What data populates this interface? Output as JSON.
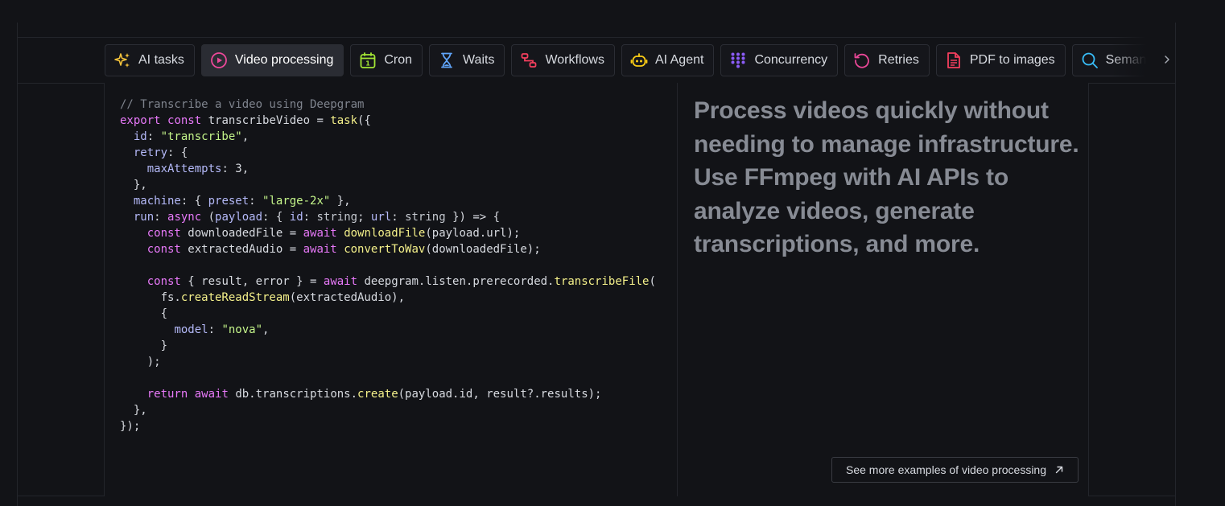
{
  "tabs": [
    {
      "label": "AI tasks",
      "icon": "sparkles-icon",
      "color": "#f5c33b",
      "active": false
    },
    {
      "label": "Video processing",
      "icon": "play-circle-icon",
      "color": "#ec4899",
      "active": true
    },
    {
      "label": "Cron",
      "icon": "calendar-icon",
      "color": "#a3e635",
      "active": false
    },
    {
      "label": "Waits",
      "icon": "hourglass-icon",
      "color": "#60a5fa",
      "active": false
    },
    {
      "label": "Workflows",
      "icon": "workflow-icon",
      "color": "#f43f5e",
      "active": false
    },
    {
      "label": "AI Agent",
      "icon": "robot-icon",
      "color": "#facc15",
      "active": false
    },
    {
      "label": "Concurrency",
      "icon": "grid-dots-icon",
      "color": "#8b5cf6",
      "active": false
    },
    {
      "label": "Retries",
      "icon": "retry-icon",
      "color": "#ec4899",
      "active": false
    },
    {
      "label": "PDF to images",
      "icon": "pdf-file-icon",
      "color": "#f43f5e",
      "active": false
    },
    {
      "label": "Semantic search",
      "icon": "search-icon",
      "color": "#38bdf8",
      "active": false
    }
  ],
  "code_lines": [
    "// Transcribe a video using Deepgram",
    "export const transcribeVideo = task({",
    "  id: \"transcribe\",",
    "  retry: {",
    "    maxAttempts: 3,",
    "  },",
    "  machine: { preset: \"large-2x\" },",
    "  run: async (payload: { id: string; url: string }) => {",
    "    const downloadedFile = await downloadFile(payload.url);",
    "    const extractedAudio = await convertToWav(downloadedFile);",
    "",
    "    const { result, error } = await deepgram.listen.prerecorded.transcribeFile(",
    "      fs.createReadStream(extractedAudio),",
    "      {",
    "        model: \"nova\",",
    "      }",
    "    );",
    "",
    "    return await db.transcriptions.create(payload.id, result?.results);",
    "  },",
    "});"
  ],
  "description": "Process videos quickly without needing to manage infrastructure. Use FFmpeg with AI APIs to analyze videos, generate transcriptions, and more.",
  "more_button": {
    "label": "See more examples of video processing",
    "icon": "arrow-up-right-icon"
  },
  "scroll_icon": "chevron-right-icon"
}
